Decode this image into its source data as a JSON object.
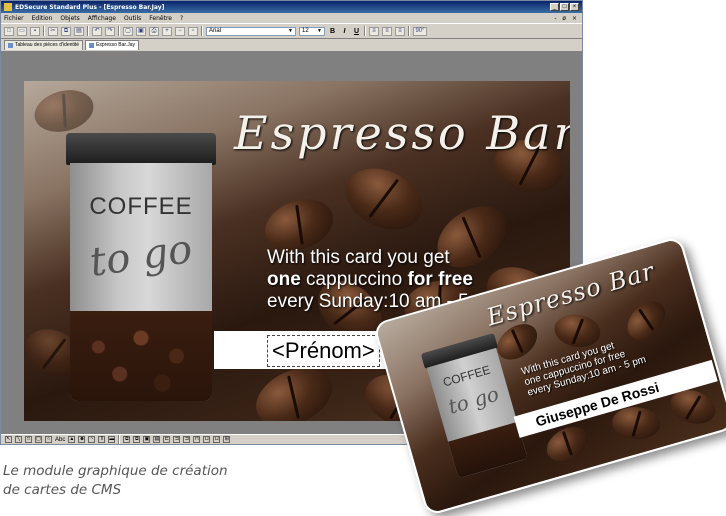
{
  "window": {
    "title": "EDSecure Standard Plus - [Espresso Bar.Jay]",
    "buttons": [
      "_",
      "□",
      "×"
    ]
  },
  "menu": {
    "items": [
      "Fichier",
      "Edition",
      "Objets",
      "Affichage",
      "Outils",
      "Fenêtre",
      "?"
    ],
    "right_controls": "- ø ×"
  },
  "toolbar": {
    "font_name": "Arial",
    "font_size": "12",
    "bold": "B",
    "italic": "I",
    "underline": "U",
    "rotation": "90°"
  },
  "tabs": [
    {
      "label": "Tableau des pièces d'identité"
    },
    {
      "label": "Espresso Bar.Jay"
    }
  ],
  "card": {
    "title": "Espresso Bar",
    "cup_top": "COFFEE",
    "cup_bottom": "to go",
    "line1": "With this card you get",
    "line2_bold_a": "one",
    "line2_normal": " cappuccino ",
    "line2_bold_b": "for free",
    "line3": "every Sunday:10 am - 5 pm",
    "name_placeholder": "<Prénom>"
  },
  "printed_card": {
    "title": "Espresso Bar",
    "cup_top": "COFFEE",
    "cup_bottom": "to go",
    "line1": "With this card you get",
    "line2": "one cappuccino for free",
    "line3": "every Sunday:10 am - 5 pm",
    "name": "Giuseppe De Rossi"
  },
  "drawing_toolbar": {
    "text_tool": "Abc"
  },
  "caption": {
    "line1": "Le module graphique de création",
    "line2": "de cartes de CMS"
  }
}
